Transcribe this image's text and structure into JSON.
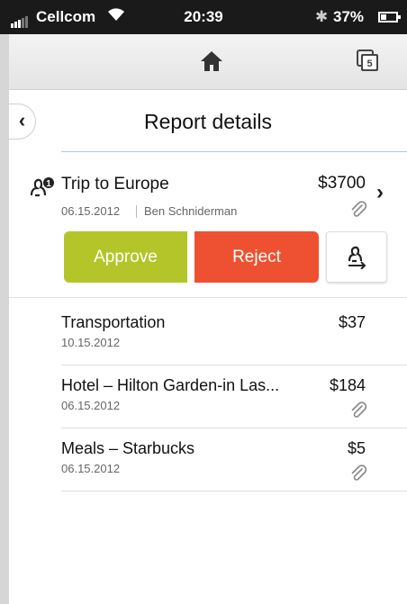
{
  "status_bar": {
    "carrier": "Cellcom",
    "time": "20:39",
    "battery": "37%",
    "icons": [
      "signal-icon",
      "wifi-icon",
      "bluetooth-icon",
      "battery-icon"
    ]
  },
  "top_nav": {
    "icons": [
      "home-icon",
      "stack-icon"
    ],
    "stack_badge": "5"
  },
  "header": {
    "back_label": "‹",
    "title": "Report details"
  },
  "report": {
    "name": "Trip to Europe",
    "amount": "$3700",
    "date": "06.15.2012",
    "submitter": "Ben Schniderman",
    "approver_badge": "1",
    "approve_label": "Approve",
    "reject_label": "Reject",
    "chevron": "›",
    "colors": {
      "approve": "#b4c52a",
      "reject": "#ee5131",
      "accent_rule": "#9fd0d8"
    }
  },
  "expenses": [
    {
      "name": "Transportation",
      "amount": "$37",
      "date": "10.15.2012",
      "has_attachment": false
    },
    {
      "name": "Hotel – Hilton Garden-in Las...",
      "amount": "$184",
      "date": "06.15.2012",
      "has_attachment": true
    },
    {
      "name": "Meals – Starbucks",
      "amount": "$5",
      "date": "06.15.2012",
      "has_attachment": true
    }
  ]
}
